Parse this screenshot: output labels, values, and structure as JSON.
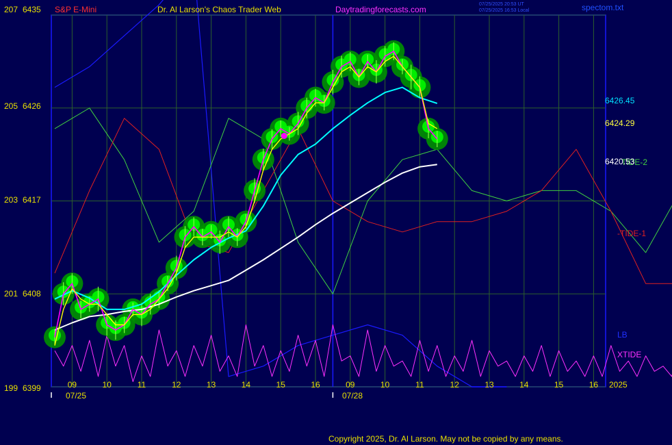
{
  "header": {
    "symbol": "S&P E-Mini",
    "title": "Dr. Al Larson's Chaos Trader Web",
    "site": "Daytradingforecasts.com",
    "stamp_line1": "07/25/2025 20:53 UT",
    "stamp_line2": "07/25/2025 16:53 Local",
    "file": "spectom.txt"
  },
  "copyright": "Copyright 2025, Dr. Al Larson. May not be copied by any means.",
  "colors": {
    "background": "#000050",
    "frame": "#1818ff",
    "grid": "#2c5f2c",
    "price": "#ff00ff",
    "fast_avg": "#ffff00",
    "mid_avg": "#00ffff",
    "slow_avg": "#ffffff",
    "tide1": "#e02020",
    "tide2": "#40d040",
    "lb": "#1a1aff",
    "xtide": "#ff30ff",
    "halo": "#00ee00",
    "text_yellow": "#e8e000"
  },
  "chart_data": {
    "type": "line",
    "y_axis": {
      "min": 6399,
      "max": 6435,
      "ticks": [
        {
          "left": "207",
          "right": "6435",
          "price": 6435
        },
        {
          "left": "205",
          "right": "6426",
          "price": 6426
        },
        {
          "left": "203",
          "right": "6417",
          "price": 6417
        },
        {
          "left": "201",
          "right": "6408",
          "price": 6408
        },
        {
          "left": "199",
          "right": "6399",
          "price": 6399
        }
      ]
    },
    "x_axis": {
      "hour_labels": [
        "09",
        "10",
        "11",
        "12",
        "13",
        "14",
        "15",
        "16",
        "09",
        "10",
        "11",
        "12",
        "13",
        "14",
        "15",
        "16"
      ],
      "session_dates": [
        "07/25",
        "07/28"
      ],
      "year_label": "2025"
    },
    "right_labels": {
      "mid_avg_value": "6426.45",
      "fast_avg_value": "6424.29",
      "slow_avg_value": "6420.53",
      "tide2": "TIDE-2",
      "tide1": "-TIDE-1",
      "lb": "LB",
      "xtide": "XTIDE"
    },
    "series": [
      {
        "key": "price",
        "sample_step_hours": 0.25,
        "values": [
          6403.8,
          6408.0,
          6409.0,
          6406.5,
          6407.0,
          6407.5,
          6405.0,
          6404.5,
          6405.0,
          6406.5,
          6406.0,
          6407.0,
          6407.5,
          6409.0,
          6410.5,
          6413.5,
          6414.5,
          6413.5,
          6414.0,
          6413.0,
          6414.5,
          6413.5,
          6415.0,
          6418.0,
          6421.0,
          6423.0,
          6424.0,
          6423.5,
          6424.5,
          6426.0,
          6427.0,
          6426.5,
          6428.5,
          6430.0,
          6430.5,
          6429.0,
          6430.5,
          6429.5,
          6431.0,
          6431.5,
          6430.0,
          6429.0,
          6428.0,
          6424.0,
          6423.0
        ]
      },
      {
        "key": "fast_avg",
        "sample_step_hours": 0.25,
        "values": [
          6403.0,
          6406.5,
          6408.5,
          6407.5,
          6407.0,
          6407.0,
          6406.0,
          6405.0,
          6405.0,
          6406.0,
          6406.0,
          6406.5,
          6407.5,
          6408.5,
          6410.0,
          6412.5,
          6413.5,
          6413.5,
          6413.5,
          6413.5,
          6414.0,
          6413.5,
          6414.5,
          6417.0,
          6420.0,
          6422.0,
          6423.0,
          6423.5,
          6424.0,
          6425.5,
          6426.5,
          6426.5,
          6428.0,
          6429.5,
          6430.0,
          6429.0,
          6430.0,
          6429.5,
          6430.5,
          6431.0,
          6430.0,
          6429.0,
          6428.0,
          6424.5,
          6424.0
        ]
      },
      {
        "key": "mid_avg",
        "sample_step_hours": 0.5,
        "values": [
          6407.5,
          6408.3,
          6407.6,
          6406.5,
          6406.5,
          6407.0,
          6408.2,
          6409.8,
          6411.3,
          6412.5,
          6413.4,
          6414.1,
          6416.5,
          6419.5,
          6421.5,
          6422.5,
          6424.0,
          6425.3,
          6426.5,
          6427.5,
          6428.0,
          6427.0,
          6426.45
        ]
      },
      {
        "key": "slow_avg",
        "sample_step_hours": 0.5,
        "values": [
          6404.5,
          6405.2,
          6405.8,
          6406.0,
          6406.3,
          6406.5,
          6407.0,
          6407.7,
          6408.3,
          6408.8,
          6409.3,
          6410.3,
          6411.3,
          6412.4,
          6413.5,
          6414.7,
          6415.8,
          6416.8,
          6417.8,
          6418.8,
          6419.7,
          6420.3,
          6420.53
        ]
      },
      {
        "key": "tide2",
        "sample_step_hours": 1,
        "values": [
          6424,
          6426,
          6421,
          6413,
          6416,
          6425,
          6423,
          6413,
          6408,
          6417,
          6421,
          6422,
          6418,
          6417,
          6418,
          6418,
          6416,
          6412,
          6418,
          6426,
          6424,
          6426,
          6418
        ]
      },
      {
        "key": "tide1",
        "sample_step_hours": 1,
        "values": [
          6410,
          6418,
          6425,
          6422,
          6413,
          6412,
          6418,
          6424,
          6417,
          6415,
          6414,
          6415,
          6415,
          6416,
          6418,
          6422,
          6416,
          6409,
          6409,
          6415
        ]
      },
      {
        "key": "lb",
        "sample_step_hours": 1,
        "values": [
          6428,
          6430,
          6433,
          6436,
          6440,
          6400,
          6401,
          6403,
          6404,
          6405,
          6404,
          6401,
          6399,
          6399
        ]
      },
      {
        "key": "xtide",
        "sample_step_hours": 0.25,
        "values": [
          6402.5,
          6401,
          6403,
          6400.5,
          6403.5,
          6400,
          6404,
          6401,
          6403,
          6399.5,
          6402,
          6400,
          6404.5,
          6401,
          6402.5,
          6400,
          6403,
          6401,
          6404,
          6400.5,
          6402,
          6400,
          6405,
          6401,
          6403,
          6400,
          6402.5,
          6400.5,
          6404,
          6401,
          6403.5,
          6400,
          6405,
          6401.5,
          6402,
          6400,
          6404.5,
          6400.5,
          6403,
          6401,
          6401.5,
          6400,
          6403.5,
          6400.5,
          6403,
          6400,
          6402,
          6400.5,
          6403.5,
          6400,
          6402.5,
          6401,
          6401.5,
          6400,
          6402,
          6400.5,
          6403,
          6400,
          6402.5,
          6400.5,
          6401.5,
          6400,
          6402,
          6400,
          6403,
          6400.5,
          6401.5,
          6400,
          6402,
          6400.5,
          6401,
          6400,
          6404,
          6401,
          6403.5,
          6400.5,
          6404.5,
          6401,
          6403,
          6401.5,
          6402,
          6401,
          6402.5,
          6401,
          6401.5,
          6401.5
        ]
      },
      {
        "key": "buy_dot",
        "x_hour": 6.6,
        "price": 6423.3
      }
    ]
  }
}
